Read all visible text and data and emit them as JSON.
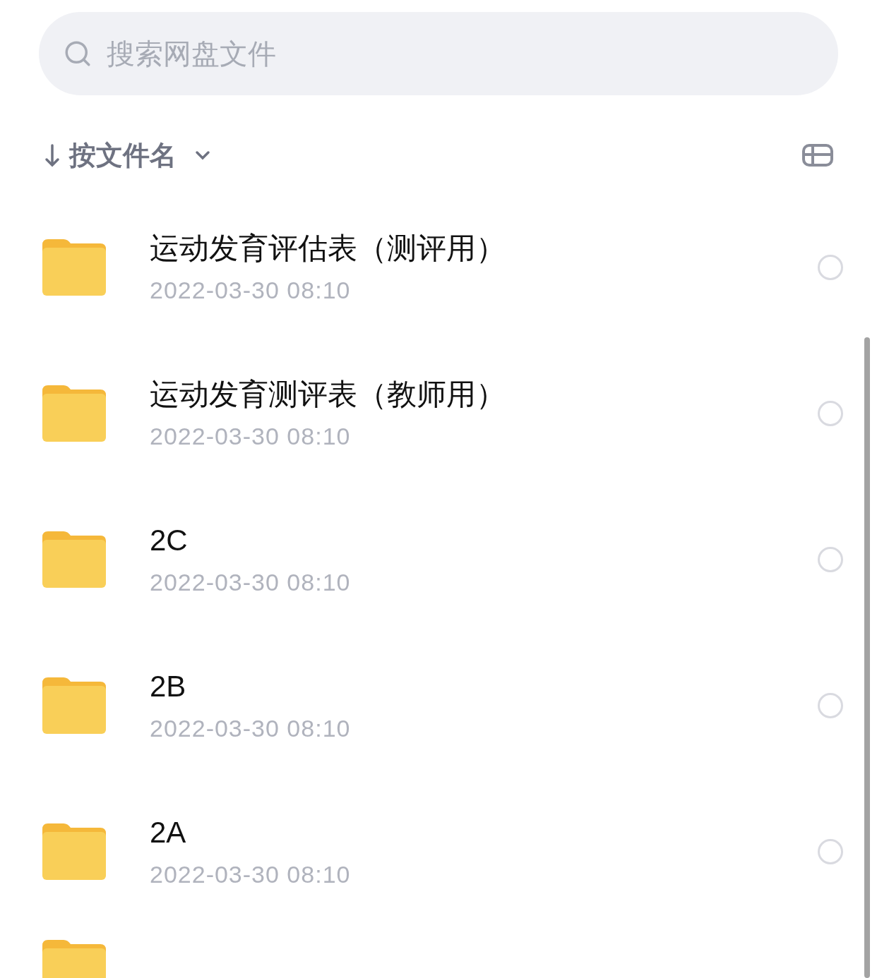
{
  "search": {
    "placeholder": "搜索网盘文件"
  },
  "sort": {
    "label": "按文件名"
  },
  "files": [
    {
      "name": "运动发育评估表（测评用）",
      "date": "2022-03-30 08:10",
      "selected": false
    },
    {
      "name": "运动发育测评表（教师用）",
      "date": "2022-03-30 08:10",
      "selected": false
    },
    {
      "name": "2C",
      "date": "2022-03-30 08:10",
      "selected": false
    },
    {
      "name": "2B",
      "date": "2022-03-30 08:10",
      "selected": false
    },
    {
      "name": "2A",
      "date": "2022-03-30 08:10",
      "selected": false
    }
  ]
}
